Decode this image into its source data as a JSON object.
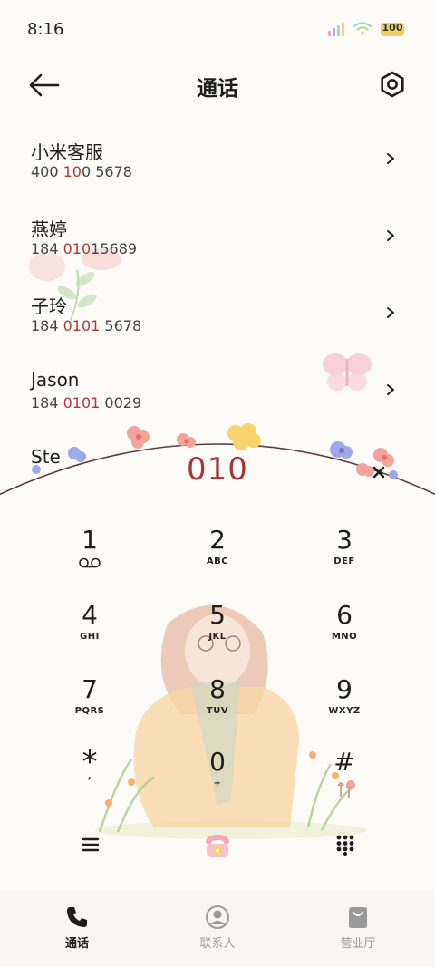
{
  "status_bar": {
    "time": "8:16",
    "battery": "100"
  },
  "header": {
    "title": "通话"
  },
  "contacts": [
    {
      "name": "小米客服",
      "number_pre": "400 ",
      "number_hl": "10",
      "number_post": "0 5678"
    },
    {
      "name": "燕婷",
      "number_pre": "184 ",
      "number_hl": "010",
      "number_post": "15689"
    },
    {
      "name": "子玲",
      "number_pre": "184 ",
      "number_hl": "0101",
      "number_post": " 5678"
    },
    {
      "name": "Jason",
      "number_pre": "184 ",
      "number_hl": "0101",
      "number_post": " 0029"
    },
    {
      "name": "Ste",
      "number_pre": "",
      "number_hl": "",
      "number_post": ""
    }
  ],
  "dialer": {
    "input": "010",
    "keys": [
      {
        "digit": "1",
        "letters": ""
      },
      {
        "digit": "2",
        "letters": "ABC"
      },
      {
        "digit": "3",
        "letters": "DEF"
      },
      {
        "digit": "4",
        "letters": "GHI"
      },
      {
        "digit": "5",
        "letters": "JKL"
      },
      {
        "digit": "6",
        "letters": "MNO"
      },
      {
        "digit": "7",
        "letters": "PQRS"
      },
      {
        "digit": "8",
        "letters": "TUV"
      },
      {
        "digit": "9",
        "letters": "WXYZ"
      },
      {
        "digit": "*",
        "letters": ","
      },
      {
        "digit": "0",
        "letters": "+"
      },
      {
        "digit": "#",
        "letters": ""
      }
    ]
  },
  "bottom_nav": [
    {
      "label": "通话",
      "icon": "phone-icon",
      "active": true
    },
    {
      "label": "联系人",
      "icon": "person-icon",
      "active": false
    },
    {
      "label": "营业厅",
      "icon": "shopping-bag-icon",
      "active": false
    }
  ],
  "colors": {
    "accent_red": "#a6363a",
    "background": "#fcfbf7",
    "nav_active": "#1d1d1d",
    "nav_inactive": "#9a9a9a"
  }
}
